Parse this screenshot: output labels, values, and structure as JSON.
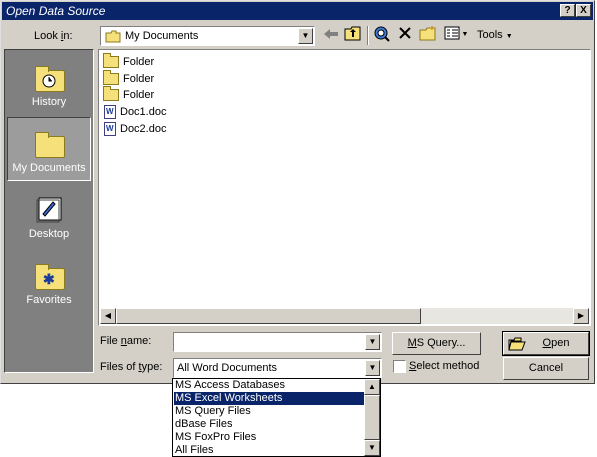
{
  "window": {
    "title": "Open Data Source",
    "help_button": "?",
    "close_button": "X"
  },
  "toolbar": {
    "look_in_label": "Look in:",
    "look_in_value": "My Documents",
    "tools_label": "Tools"
  },
  "places": [
    {
      "label": "History",
      "icon": "history-icon",
      "selected": false
    },
    {
      "label": "My Documents",
      "icon": "my-documents-folder-icon",
      "selected": true
    },
    {
      "label": "Desktop",
      "icon": "desktop-icon",
      "selected": false
    },
    {
      "label": "Favorites",
      "icon": "favorites-folder-icon",
      "selected": false
    }
  ],
  "files": [
    {
      "name": "Folder",
      "type": "folder"
    },
    {
      "name": "Folder",
      "type": "folder"
    },
    {
      "name": "Folder",
      "type": "folder"
    },
    {
      "name": "Doc1.doc",
      "type": "word-document"
    },
    {
      "name": "Doc2.doc",
      "type": "word-document"
    }
  ],
  "form": {
    "file_name_label": "File name:",
    "file_name_value": "",
    "files_of_type_label": "Files of type:",
    "files_of_type_value": "All Word Documents",
    "ms_query_button": "MS Query...",
    "select_method_label": "Select method",
    "select_method_checked": false,
    "open_button": "Open",
    "cancel_button": "Cancel"
  },
  "type_dropdown": {
    "options": [
      "MS Access Databases",
      "MS Excel Worksheets",
      "MS Query Files",
      "dBase Files",
      "MS FoxPro Files",
      "All Files"
    ],
    "highlighted": "MS Excel Worksheets"
  }
}
